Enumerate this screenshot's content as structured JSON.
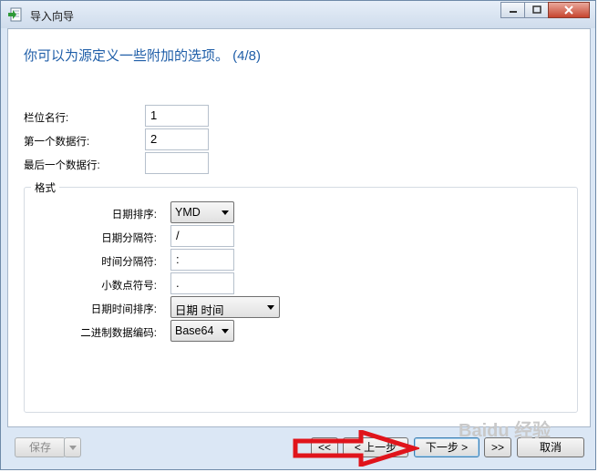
{
  "window": {
    "title": "导入向导"
  },
  "wizard": {
    "heading": "你可以为源定义一些附加的选项。 (4/8)"
  },
  "fields": {
    "field_name_row": {
      "label": "栏位名行:",
      "value": "1"
    },
    "first_data_row": {
      "label": "第一个数据行:",
      "value": "2"
    },
    "last_data_row": {
      "label": "最后一个数据行:",
      "value": ""
    }
  },
  "format": {
    "group_label": "格式",
    "date_order": {
      "label": "日期排序:",
      "value": "YMD"
    },
    "date_separator": {
      "label": "日期分隔符:",
      "value": "/"
    },
    "time_separator": {
      "label": "时间分隔符:",
      "value": ":"
    },
    "decimal_symbol": {
      "label": "小数点符号:",
      "value": "."
    },
    "datetime_order": {
      "label": "日期时间排序:",
      "value": "日期 时间"
    },
    "binary_encoding": {
      "label": "二进制数据编码:",
      "value": "Base64"
    }
  },
  "buttons": {
    "save": "保存",
    "first": "<<",
    "back": "< 上一步",
    "next": "下一步 >",
    "last": ">>",
    "cancel": "取消"
  },
  "watermark": "Baidu 经验",
  "colors": {
    "heading": "#1f5ea8",
    "arrow": "#e0141b"
  }
}
